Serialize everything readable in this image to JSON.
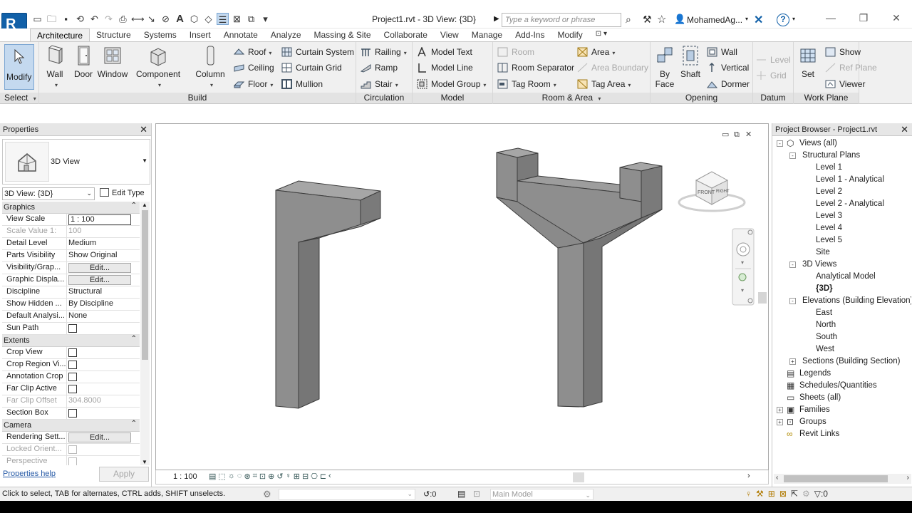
{
  "window": {
    "doc_title": "Project1.rvt - 3D View: {3D}",
    "search_placeholder": "Type a keyword or phrase",
    "user": "MohamedAg...",
    "help": "?"
  },
  "tabs": [
    "Architecture",
    "Structure",
    "Systems",
    "Insert",
    "Annotate",
    "Analyze",
    "Massing & Site",
    "Collaborate",
    "View",
    "Manage",
    "Add-Ins",
    "Modify"
  ],
  "ribbon": {
    "select": {
      "modify": "Modify",
      "label": "Select"
    },
    "build": {
      "label": "Build",
      "wall": "Wall",
      "door": "Door",
      "window": "Window",
      "component": "Component",
      "column": "Column",
      "roof": "Roof",
      "ceiling": "Ceiling",
      "floor": "Floor",
      "curtain_system": "Curtain System",
      "curtain_grid": "Curtain Grid",
      "mullion": "Mullion"
    },
    "circulation": {
      "label": "Circulation",
      "railing": "Railing",
      "ramp": "Ramp",
      "stair": "Stair"
    },
    "model": {
      "label": "Model",
      "model_text": "Model Text",
      "model_line": "Model Line",
      "model_group": "Model Group"
    },
    "room_area": {
      "label": "Room & Area",
      "room": "Room",
      "room_separator": "Room Separator",
      "tag_room": "Tag Room",
      "area": "Area",
      "area_boundary": "Area Boundary",
      "tag_area": "Tag Area"
    },
    "opening": {
      "label": "Opening",
      "by_face": "By Face",
      "shaft": "Shaft",
      "wall": "Wall",
      "vertical": "Vertical",
      "dormer": "Dormer"
    },
    "datum": {
      "label": "Datum",
      "level": "Level",
      "grid": "Grid"
    },
    "work_plane": {
      "label": "Work Plane",
      "set": "Set",
      "show": "Show",
      "ref_plane": "Ref Plane",
      "viewer": "Viewer"
    }
  },
  "properties": {
    "title": "Properties",
    "type_name": "3D View",
    "instance": "3D View: {3D}",
    "edit_type": "Edit Type",
    "groups": [
      {
        "name": "Graphics",
        "rows": [
          {
            "k": "View Scale",
            "v": "1 : 100",
            "kind": "input"
          },
          {
            "k": "Scale Value    1:",
            "v": "100",
            "kind": "text",
            "dis": true
          },
          {
            "k": "Detail Level",
            "v": "Medium",
            "kind": "text"
          },
          {
            "k": "Parts Visibility",
            "v": "Show Original",
            "kind": "text"
          },
          {
            "k": "Visibility/Grap...",
            "v": "Edit...",
            "kind": "button"
          },
          {
            "k": "Graphic Displa...",
            "v": "Edit...",
            "kind": "button"
          },
          {
            "k": "Discipline",
            "v": "Structural",
            "kind": "text"
          },
          {
            "k": "Show Hidden ...",
            "v": "By Discipline",
            "kind": "text"
          },
          {
            "k": "Default Analysi...",
            "v": "None",
            "kind": "text"
          },
          {
            "k": "Sun Path",
            "v": "",
            "kind": "check"
          }
        ]
      },
      {
        "name": "Extents",
        "rows": [
          {
            "k": "Crop View",
            "v": "",
            "kind": "check"
          },
          {
            "k": "Crop Region Vi...",
            "v": "",
            "kind": "check"
          },
          {
            "k": "Annotation Crop",
            "v": "",
            "kind": "check"
          },
          {
            "k": "Far Clip Active",
            "v": "",
            "kind": "check"
          },
          {
            "k": "Far Clip Offset",
            "v": "304.8000",
            "kind": "text",
            "dis": true
          },
          {
            "k": "Section Box",
            "v": "",
            "kind": "check"
          }
        ]
      },
      {
        "name": "Camera",
        "rows": [
          {
            "k": "Rendering Sett...",
            "v": "Edit...",
            "kind": "button"
          },
          {
            "k": "Locked Orient...",
            "v": "",
            "kind": "check",
            "dis": true
          },
          {
            "k": "Perspective",
            "v": "",
            "kind": "check",
            "dis": true
          }
        ]
      }
    ],
    "help": "Properties help",
    "apply": "Apply"
  },
  "viewport": {
    "scale": "1 : 100",
    "viewcube": {
      "front": "FRONT",
      "right": "RIGHT"
    }
  },
  "browser": {
    "title": "Project Browser - Project1.rvt",
    "items": [
      {
        "t": "Views (all)",
        "d": 0,
        "e": "-",
        "icon": "views"
      },
      {
        "t": "Structural Plans",
        "d": 1,
        "e": "-"
      },
      {
        "t": "Level 1",
        "d": 2
      },
      {
        "t": "Level 1 - Analytical",
        "d": 2
      },
      {
        "t": "Level 2",
        "d": 2
      },
      {
        "t": "Level 2 - Analytical",
        "d": 2
      },
      {
        "t": "Level 3",
        "d": 2
      },
      {
        "t": "Level 4",
        "d": 2
      },
      {
        "t": "Level 5",
        "d": 2
      },
      {
        "t": "Site",
        "d": 2
      },
      {
        "t": "3D Views",
        "d": 1,
        "e": "-"
      },
      {
        "t": "Analytical Model",
        "d": 2
      },
      {
        "t": "{3D}",
        "d": 2,
        "sel": true
      },
      {
        "t": "Elevations (Building Elevation)",
        "d": 1,
        "e": "-"
      },
      {
        "t": "East",
        "d": 2
      },
      {
        "t": "North",
        "d": 2
      },
      {
        "t": "South",
        "d": 2
      },
      {
        "t": "West",
        "d": 2
      },
      {
        "t": "Sections (Building Section)",
        "d": 1,
        "e": "+"
      },
      {
        "t": "Legends",
        "d": 0,
        "icon": "legends"
      },
      {
        "t": "Schedules/Quantities",
        "d": 0,
        "icon": "schedules"
      },
      {
        "t": "Sheets (all)",
        "d": 0,
        "icon": "sheets"
      },
      {
        "t": "Families",
        "d": 0,
        "e": "+",
        "icon": "families"
      },
      {
        "t": "Groups",
        "d": 0,
        "e": "+",
        "icon": "groups"
      },
      {
        "t": "Revit Links",
        "d": 0,
        "icon": "links"
      }
    ]
  },
  "status": {
    "text": "Click to select, TAB for alternates, CTRL adds, SHIFT unselects.",
    "worksets_count": ":0",
    "model": "Main Model",
    "filter_count": ":0"
  },
  "colors": {
    "accent": "#1160a8",
    "modify_bg": "#c4d9ef",
    "concrete": "#8c8c8c"
  }
}
